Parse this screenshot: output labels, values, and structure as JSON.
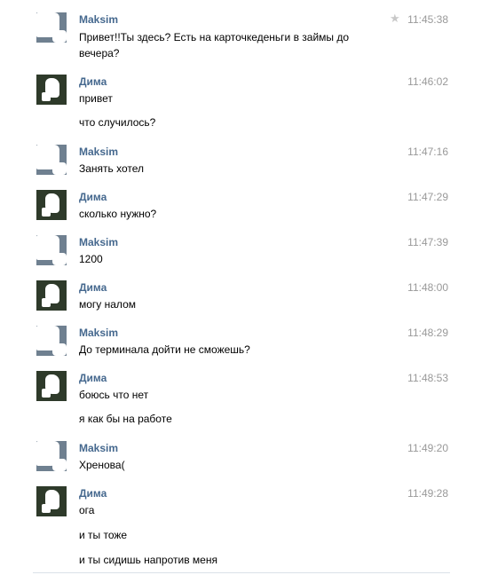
{
  "messages": [
    {
      "author": "Maksim",
      "time": "11:45:38",
      "lines": [
        "Привет!!Ты здесь? Есть на карточкеденьги в займы до вечера?"
      ],
      "avatar_icon": "user-avatar-icon",
      "starred_icon": "star-icon"
    },
    {
      "author": "Дима",
      "time": "11:46:02",
      "lines": [
        "привет",
        "что случилось?"
      ],
      "avatar_icon": "user-avatar-icon"
    },
    {
      "author": "Maksim",
      "time": "11:47:16",
      "lines": [
        "Занять хотел"
      ],
      "avatar_icon": "user-avatar-icon"
    },
    {
      "author": "Дима",
      "time": "11:47:29",
      "lines": [
        "сколько нужно?"
      ],
      "avatar_icon": "user-avatar-icon"
    },
    {
      "author": "Maksim",
      "time": "11:47:39",
      "lines": [
        "1200"
      ],
      "avatar_icon": "user-avatar-icon"
    },
    {
      "author": "Дима",
      "time": "11:48:00",
      "lines": [
        "могу налом"
      ],
      "avatar_icon": "user-avatar-icon"
    },
    {
      "author": "Maksim",
      "time": "11:48:29",
      "lines": [
        "До терминала дойти не сможешь?"
      ],
      "avatar_icon": "user-avatar-icon"
    },
    {
      "author": "Дима",
      "time": "11:48:53",
      "lines": [
        "боюсь что нет",
        "я как бы на работе"
      ],
      "avatar_icon": "user-avatar-icon"
    },
    {
      "author": "Maksim",
      "time": "11:49:20",
      "lines": [
        "Хренова("
      ],
      "avatar_icon": "user-avatar-icon"
    },
    {
      "author": "Дима",
      "time": "11:49:28",
      "lines": [
        "ога",
        "и ты тоже",
        "и ты сидишь напротив меня"
      ],
      "avatar_icon": "user-avatar-icon"
    }
  ],
  "colors": {
    "author": "#45688e",
    "time": "#999999",
    "star": "#c8c8c8"
  }
}
